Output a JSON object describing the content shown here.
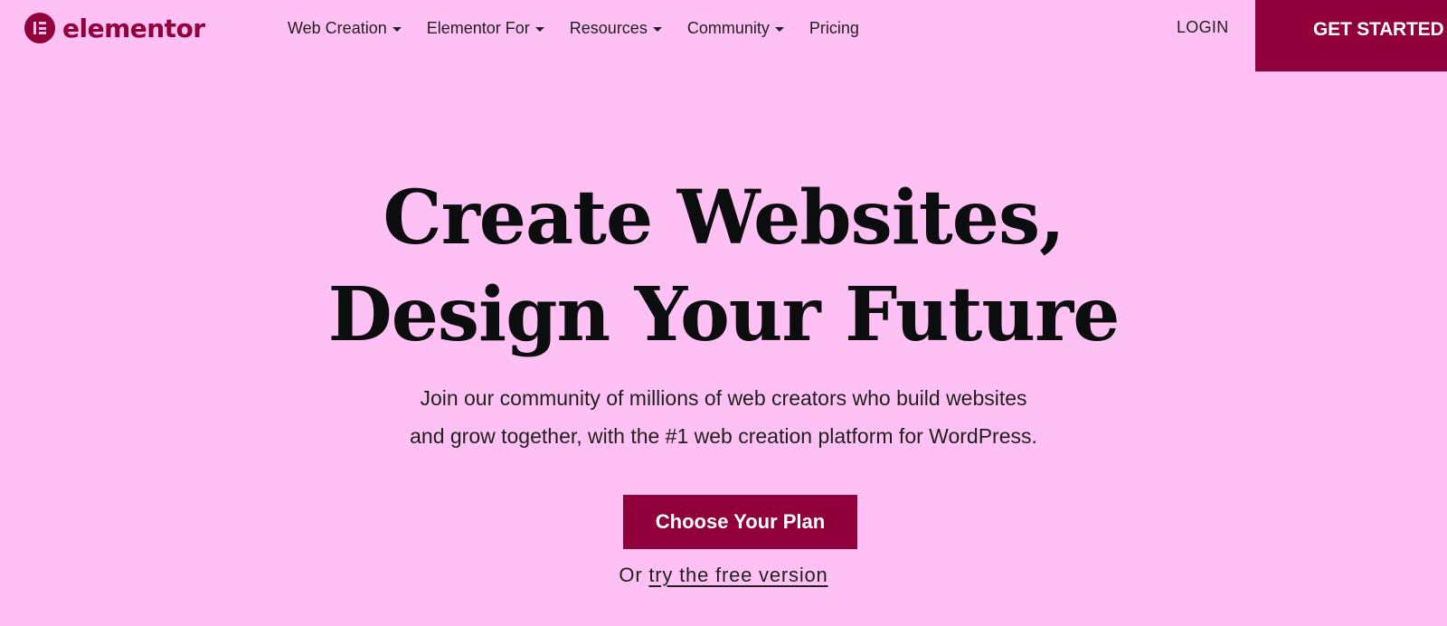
{
  "brand": {
    "name": "elementor",
    "color": "#92003b",
    "background": "#ffc1f4"
  },
  "nav": {
    "items": [
      {
        "label": "Web Creation",
        "has_dropdown": true
      },
      {
        "label": "Elementor For",
        "has_dropdown": true
      },
      {
        "label": "Resources",
        "has_dropdown": true
      },
      {
        "label": "Community",
        "has_dropdown": true
      },
      {
        "label": "Pricing",
        "has_dropdown": false
      }
    ],
    "dropdown_icon": "caret-down-icon"
  },
  "header": {
    "login_label": "LOGIN",
    "get_started_label": "GET STARTED"
  },
  "hero": {
    "title_line1": "Create Websites,",
    "title_line2": "Design Your Future",
    "subtitle_line1": "Join our community of millions of web creators who build websites",
    "subtitle_line2": "and grow together, with the #1 web creation platform for WordPress.",
    "cta_label": "Choose Your Plan",
    "free_prefix": "Or",
    "free_link": "try the free version"
  }
}
